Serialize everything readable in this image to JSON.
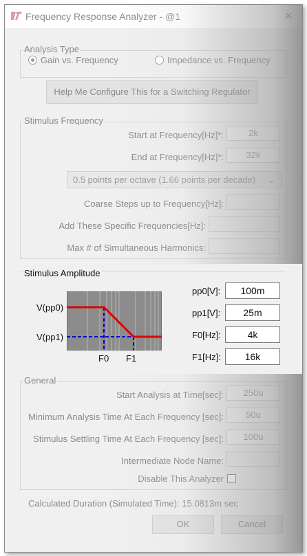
{
  "window": {
    "title": "Frequency Response Analyzer - @1",
    "close": "✕"
  },
  "analysis_type": {
    "label": "Analysis Type",
    "options": [
      {
        "label": "Gain vs. Frequency",
        "selected": true
      },
      {
        "label": "Impedance vs. Frequency",
        "selected": false
      }
    ]
  },
  "help_button": "Help Me Configure This for a Switching Regulator",
  "stimulus_frequency": {
    "label": "Stimulus Frequency",
    "start_label": "Start at Frequency[Hz]*:",
    "start_value": "2k",
    "end_label": "End at Frequency[Hz]*:",
    "end_value": "32k",
    "points_option": "0.5 points per octave (1.66 points per decade)",
    "coarse_label": "Coarse Steps up to Frequency[Hz]:",
    "coarse_value": "",
    "specific_label": "Add These Specific Frequencies[Hz]:",
    "specific_value": "",
    "harmonics_label": "Max # of Simultaneous Harmonics:",
    "harmonics_value": ""
  },
  "stimulus_amplitude": {
    "label": "Stimulus Amplitude",
    "diagram": {
      "vpp0": "V(pp0)",
      "vpp1": "V(pp1)",
      "f0": "F0",
      "f1": "F1"
    },
    "pp0_label": "pp0[V]:",
    "pp0_value": "100m",
    "pp1_label": "pp1[V]:",
    "pp1_value": "25m",
    "f0_label": "F0[Hz]:",
    "f0_value": "4k",
    "f1_label": "F1[Hz]:",
    "f1_value": "16k"
  },
  "general": {
    "label": "General",
    "start_time_label": "Start Analysis at Time[sec]:",
    "start_time_value": "250u",
    "min_time_label": "Minimum Analysis Time At Each Frequency [sec]:",
    "min_time_value": "50u",
    "settling_label": "Stimulus Settling Time At Each Frequency [sec]:",
    "settling_value": "100u",
    "node_label": "Intermediate Node Name:",
    "node_value": "",
    "disable_label": "Disable This Analyzer"
  },
  "duration_text": "Calculated Duration (Simulated Time): 15.0813m sec",
  "buttons": {
    "ok": "OK",
    "cancel": "Cancel"
  },
  "colors": {
    "curve": "#e00000",
    "dashed": "#0000cc"
  }
}
